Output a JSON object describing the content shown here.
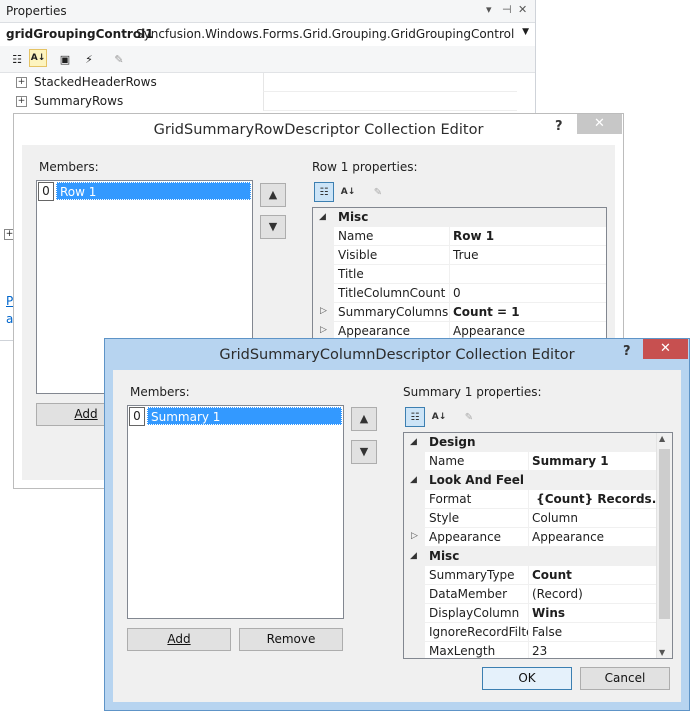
{
  "properties_panel": {
    "title": "Properties",
    "title_controls": [
      "▾",
      "⊣",
      "✕"
    ],
    "object_name": "gridGroupingControl1",
    "object_type": "Syncfusion.Windows.Forms.Grid.Grouping.GridGroupingControl",
    "rows": [
      {
        "label": "StackedHeaderRows"
      },
      {
        "label": "SummaryRows"
      }
    ],
    "left_fragments": [
      "P",
      "a"
    ]
  },
  "row_editor": {
    "title": "GridSummaryRowDescriptor Collection Editor",
    "help": "?",
    "close": "✕",
    "members_label": "Members:",
    "members": [
      {
        "index": "0",
        "name": "Row 1"
      }
    ],
    "add_label": "Add",
    "props_label": "Row 1 properties:",
    "grid": [
      {
        "type": "category",
        "name": "Misc"
      },
      {
        "type": "prop",
        "name": "Name",
        "value": "Row 1",
        "bold": true
      },
      {
        "type": "prop",
        "name": "Visible",
        "value": "True"
      },
      {
        "type": "prop",
        "name": "Title",
        "value": ""
      },
      {
        "type": "prop",
        "name": "TitleColumnCount",
        "value": "0"
      },
      {
        "type": "prop",
        "name": "SummaryColumns",
        "value": "Count = 1",
        "bold": true,
        "expandable": true
      },
      {
        "type": "prop",
        "name": "Appearance",
        "value": "Appearance",
        "expandable": true
      }
    ]
  },
  "column_editor": {
    "title": "GridSummaryColumnDescriptor Collection Editor",
    "help": "?",
    "close": "✕",
    "members_label": "Members:",
    "members": [
      {
        "index": "0",
        "name": "Summary 1"
      }
    ],
    "add_label": "Add",
    "remove_label": "Remove",
    "props_label": "Summary 1 properties:",
    "ok_label": "OK",
    "cancel_label": "Cancel",
    "grid": [
      {
        "type": "category",
        "name": "Design"
      },
      {
        "type": "prop",
        "name": "Name",
        "value": "Summary 1",
        "bold": true
      },
      {
        "type": "category",
        "name": "Look And Feel"
      },
      {
        "type": "prop",
        "name": "Format",
        "value": " {Count} Records.",
        "bold": true
      },
      {
        "type": "prop",
        "name": "Style",
        "value": "Column"
      },
      {
        "type": "prop",
        "name": "Appearance",
        "value": "Appearance",
        "expandable": true
      },
      {
        "type": "category",
        "name": "Misc"
      },
      {
        "type": "prop",
        "name": "SummaryType",
        "value": "Count",
        "bold": true
      },
      {
        "type": "prop",
        "name": "DataMember",
        "value": "(Record)"
      },
      {
        "type": "prop",
        "name": "DisplayColumn",
        "value": "Wins",
        "bold": true
      },
      {
        "type": "prop",
        "name": "IgnoreRecordFilter",
        "value": "False"
      },
      {
        "type": "prop",
        "name": "MaxLength",
        "value": "23"
      }
    ]
  },
  "icons": {
    "up": "▲",
    "down": "▼",
    "wrench": "🔧",
    "bolt": "⚡",
    "categorized": "☷",
    "alpha": "A↓",
    "expand_plus": "+",
    "expand_tri": "▷",
    "collapse_tri": "◢"
  },
  "colors": {
    "selection": "#3399ff",
    "dialog_active_caption": "#b7d4f0",
    "dialog_inactive_caption": "#ffffff",
    "close_active": "#c75050",
    "close_inactive": "#c7c7c7"
  }
}
